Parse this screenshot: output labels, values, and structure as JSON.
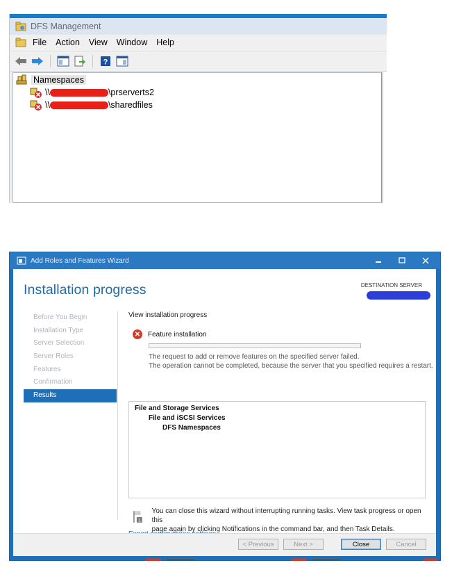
{
  "dfs": {
    "title": "DFS Management",
    "menu": [
      "File",
      "Action",
      "View",
      "Window",
      "Help"
    ],
    "toolbar_icons": [
      "back-arrow-icon",
      "forward-arrow-icon",
      "show-hide-tree-icon",
      "export-list-icon",
      "help-icon",
      "action-pane-icon"
    ],
    "tree": {
      "root": "Namespaces",
      "items": [
        {
          "prefix": "\\\\",
          "suffix": "\\prserverts2"
        },
        {
          "prefix": "\\\\",
          "suffix": "\\sharedfiles"
        }
      ]
    }
  },
  "wizard": {
    "title": "Add Roles and Features Wizard",
    "heading": "Installation progress",
    "destination_label": "DESTINATION SERVER",
    "nav": [
      {
        "label": "Before You Begin",
        "active": false
      },
      {
        "label": "Installation Type",
        "active": false
      },
      {
        "label": "Server Selection",
        "active": false
      },
      {
        "label": "Server Roles",
        "active": false
      },
      {
        "label": "Features",
        "active": false
      },
      {
        "label": "Confirmation",
        "active": false
      },
      {
        "label": "Results",
        "active": true
      }
    ],
    "subhead": "View installation progress",
    "feature_label": "Feature installation",
    "progress": 0,
    "message_1": "The request to add or remove features on the specified server failed.",
    "message_2": "The operation cannot be completed, because the server that you specified requires a restart.",
    "results": [
      "File and Storage Services",
      "File and iSCSI Services",
      "DFS Namespaces"
    ],
    "info_line_1": "You can close this wizard without interrupting running tasks. View task progress or open this",
    "info_line_2": "page again by clicking Notifications in the command bar, and then Task Details.",
    "export_link": "Export configuration settings",
    "buttons": {
      "previous": "< Previous",
      "next": "Next >",
      "close": "Close",
      "cancel": "Cancel"
    },
    "colors": {
      "accent": "#1e6fb8",
      "error": "#d23a2a",
      "link": "#1f6aa8"
    }
  }
}
